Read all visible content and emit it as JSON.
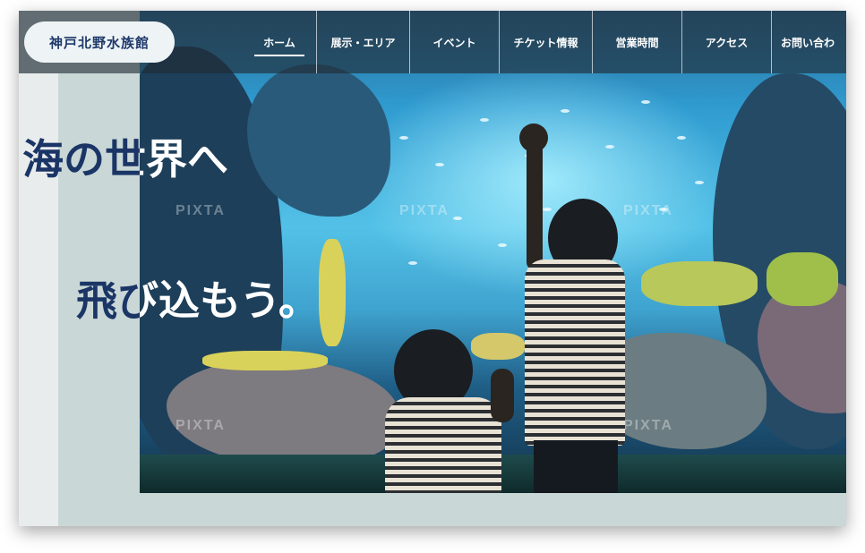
{
  "site": {
    "logo": "神戸北野水族館"
  },
  "nav": {
    "items": [
      {
        "label": "ホーム",
        "active": true
      },
      {
        "label": "展示・エリア",
        "active": false
      },
      {
        "label": "イベント",
        "active": false
      },
      {
        "label": "チケット情報",
        "active": false
      },
      {
        "label": "営業時間",
        "active": false
      },
      {
        "label": "アクセス",
        "active": false
      },
      {
        "label": "お問い合わ",
        "active": false
      }
    ]
  },
  "hero": {
    "line1": "海の世界へ",
    "line2": "飛び込もう。",
    "watermark": "PIXTA",
    "accent_color": "#1a3566"
  }
}
